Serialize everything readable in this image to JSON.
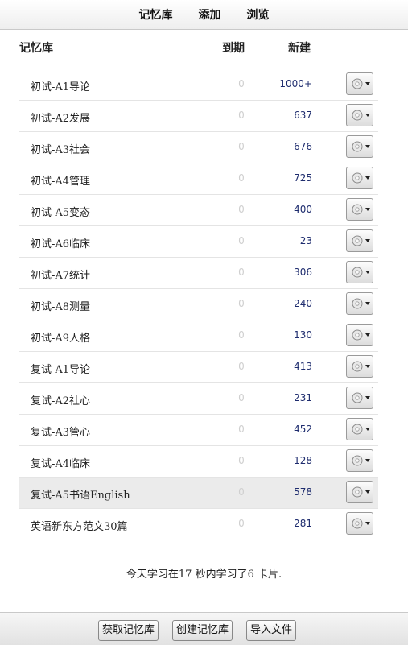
{
  "top_nav": {
    "items": [
      {
        "label": "记忆库"
      },
      {
        "label": "添加"
      },
      {
        "label": "浏览"
      }
    ]
  },
  "table": {
    "headers": {
      "deck": "记忆库",
      "due": "到期",
      "new": "新建"
    },
    "rows": [
      {
        "name": "初试-A1导论",
        "due": "0",
        "new": "1000+",
        "options_icon": "gear-icon"
      },
      {
        "name": "初试-A2发展",
        "due": "0",
        "new": "637",
        "options_icon": "gear-icon"
      },
      {
        "name": "初试-A3社会",
        "due": "0",
        "new": "676",
        "options_icon": "gear-icon"
      },
      {
        "name": "初试-A4管理",
        "due": "0",
        "new": "725",
        "options_icon": "gear-icon"
      },
      {
        "name": "初试-A5变态",
        "due": "0",
        "new": "400",
        "options_icon": "gear-icon"
      },
      {
        "name": "初试-A6临床",
        "due": "0",
        "new": "23",
        "options_icon": "gear-icon"
      },
      {
        "name": "初试-A7统计",
        "due": "0",
        "new": "306",
        "options_icon": "gear-icon"
      },
      {
        "name": "初试-A8测量",
        "due": "0",
        "new": "240",
        "options_icon": "gear-icon"
      },
      {
        "name": "初试-A9人格",
        "due": "0",
        "new": "130",
        "options_icon": "gear-icon"
      },
      {
        "name": "复试-A1导论",
        "due": "0",
        "new": "413",
        "options_icon": "gear-icon"
      },
      {
        "name": "复试-A2社心",
        "due": "0",
        "new": "231",
        "options_icon": "gear-icon"
      },
      {
        "name": "复试-A3管心",
        "due": "0",
        "new": "452",
        "options_icon": "gear-icon"
      },
      {
        "name": "复试-A4临床",
        "due": "0",
        "new": "128",
        "options_icon": "gear-icon"
      },
      {
        "name": "复试-A5书语English",
        "due": "0",
        "new": "578",
        "options_icon": "gear-icon",
        "selected": true
      },
      {
        "name": "英语新东方范文30篇",
        "due": "0",
        "new": "281",
        "options_icon": "gear-icon"
      }
    ]
  },
  "status": {
    "text": "今天学习在17 秒内学习了6 卡片."
  },
  "bottom_bar": {
    "buttons": [
      {
        "label": "获取记忆库"
      },
      {
        "label": "创建记忆库"
      },
      {
        "label": "导入文件"
      }
    ]
  },
  "colors": {
    "new_count": "#1e2c6e",
    "due_count": "#cfcfcf",
    "selected_row": "#ebebeb"
  }
}
